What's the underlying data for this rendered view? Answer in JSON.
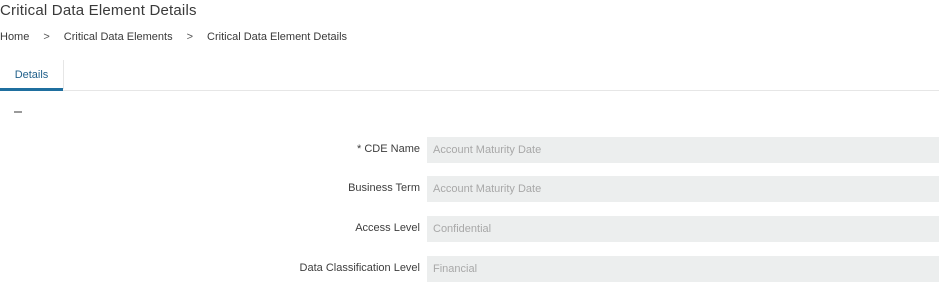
{
  "page": {
    "title": "Critical Data Element Details"
  },
  "breadcrumb": {
    "items": [
      {
        "label": "Home"
      },
      {
        "label": "Critical Data Elements"
      },
      {
        "label": "Critical Data Element Details"
      }
    ],
    "separator": ">"
  },
  "tabs": [
    {
      "label": "Details",
      "active": true
    }
  ],
  "form": {
    "fields": [
      {
        "label": "* CDE Name",
        "value": "Account Maturity Date"
      },
      {
        "label": "Business Term",
        "value": "Account Maturity Date"
      },
      {
        "label": "Access Level",
        "value": "Confidential"
      },
      {
        "label": "Data Classification Level",
        "value": "Financial"
      }
    ]
  },
  "colors": {
    "accent": "#1f6f9f",
    "field_background": "#eceeee",
    "field_text": "#a8a8a8"
  }
}
